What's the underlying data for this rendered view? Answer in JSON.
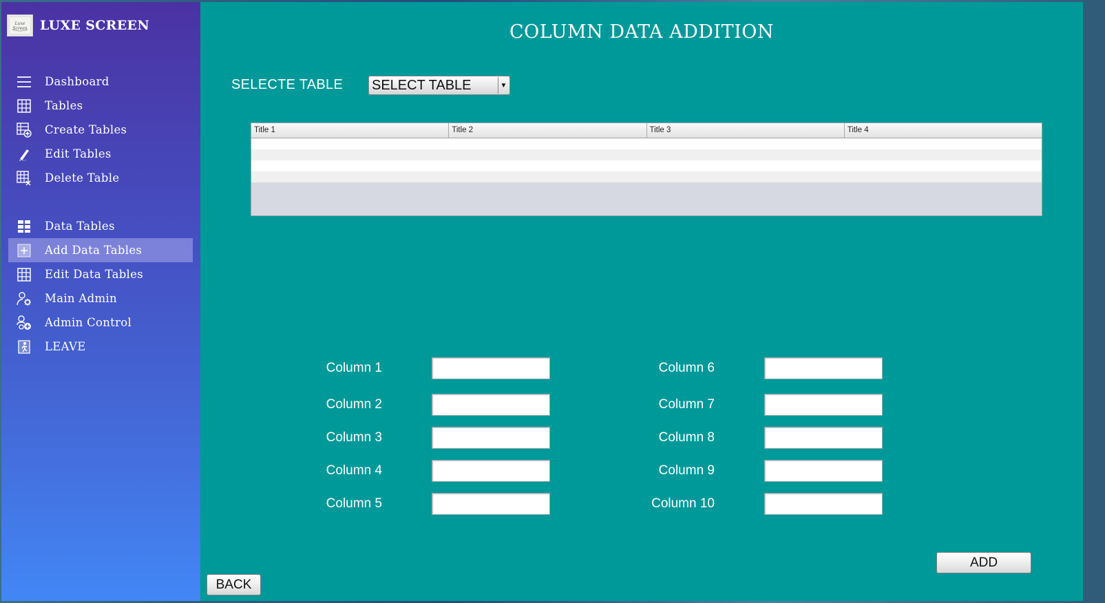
{
  "app": {
    "title": "LUXE SCREEN",
    "logo_text": "Luxe Screen"
  },
  "sidebar": {
    "items": [
      {
        "label": "Dashboard",
        "icon": "menu-icon"
      },
      {
        "label": "Tables",
        "icon": "table-grid-icon"
      },
      {
        "label": "Create Tables",
        "icon": "table-add-icon"
      },
      {
        "label": "Edit Tables",
        "icon": "pen-icon"
      },
      {
        "label": "Delete Table",
        "icon": "table-delete-icon"
      },
      {
        "label": "Data Tables",
        "icon": "data-table-icon"
      },
      {
        "label": "Add Data Tables",
        "icon": "plus-box-icon",
        "active": true
      },
      {
        "label": "Edit Data Tables",
        "icon": "table-grid-icon"
      },
      {
        "label": "Main Admin",
        "icon": "admin-gear-icon"
      },
      {
        "label": "Admin Control",
        "icon": "admin-add-icon"
      },
      {
        "label": "LEAVE",
        "icon": "exit-icon"
      }
    ]
  },
  "main": {
    "title": "COLUMN DATA ADDITION",
    "select_label": "SELECTE TABLE",
    "select_value": "SELECT TABLE",
    "table": {
      "columns": [
        "Title 1",
        "Title 2",
        "Title 3",
        "Title 4"
      ],
      "rows": [
        [
          "",
          "",
          "",
          ""
        ],
        [
          "",
          "",
          "",
          ""
        ],
        [
          "",
          "",
          "",
          ""
        ],
        [
          "",
          "",
          "",
          ""
        ]
      ]
    },
    "fields": [
      {
        "label": "Column 1",
        "value": ""
      },
      {
        "label": "Column 2",
        "value": ""
      },
      {
        "label": "Column 3",
        "value": ""
      },
      {
        "label": "Column 4",
        "value": ""
      },
      {
        "label": "Column 5",
        "value": ""
      },
      {
        "label": "Column 6",
        "value": ""
      },
      {
        "label": "Column 7",
        "value": ""
      },
      {
        "label": "Column 8",
        "value": ""
      },
      {
        "label": "Column 9",
        "value": ""
      },
      {
        "label": "Column 10",
        "value": ""
      }
    ],
    "add_label": "ADD",
    "back_label": "BACK"
  },
  "colors": {
    "main_bg": "#009999",
    "sidebar_top": "#4b32a3",
    "sidebar_bottom": "#4287f5",
    "active_item": "#9a9ae0"
  }
}
